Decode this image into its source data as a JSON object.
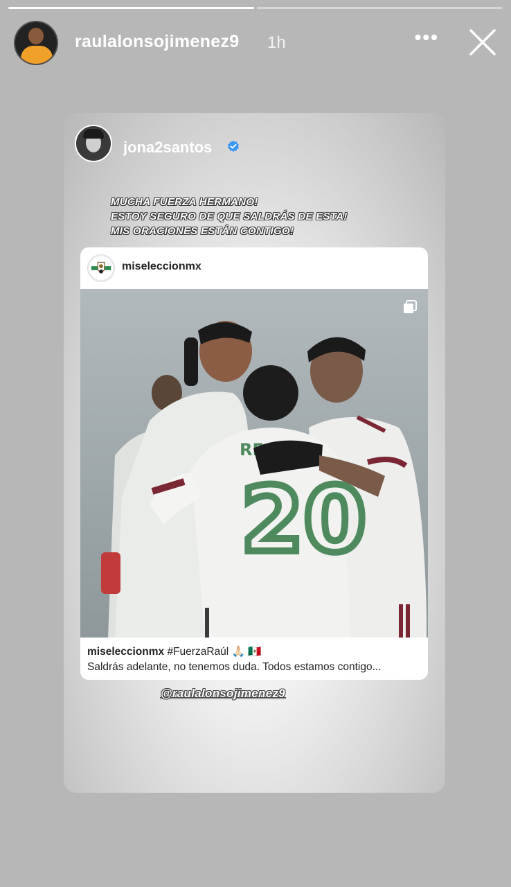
{
  "story": {
    "segments_total": 2,
    "segments_done": 1,
    "username": "raulalonsojimenez9",
    "time": "1h",
    "more_label": "•••"
  },
  "repost": {
    "username": "jona2santos",
    "caption_lines": [
      "MUCHA FUERZA HERMANO!",
      "ESTOY SEGURO DE QUE SALDRÁS DE ESTA!",
      "MIS ORACIONES ESTÁN CONTIGO!"
    ],
    "mention": "@raulalonsojimenez9"
  },
  "post": {
    "username": "miseleccionmx",
    "caption_user": "miseleccionmx",
    "caption_tag": " #FuerzaRaúl 🙏🏻 🇲🇽",
    "caption_line2": "Saldrás adelante, no tenemos duda. Todos estamos contigo...",
    "photo_jersey_number": "20",
    "photo_name": "RE"
  },
  "colors": {
    "background": "#b7b7b7",
    "verified": "#3897f0",
    "jersey_green": "#4e8a5e",
    "jersey_maroon": "#7a2733"
  },
  "icons": [
    "close-icon",
    "more-icon",
    "verified-icon",
    "multiple-posts-icon"
  ]
}
